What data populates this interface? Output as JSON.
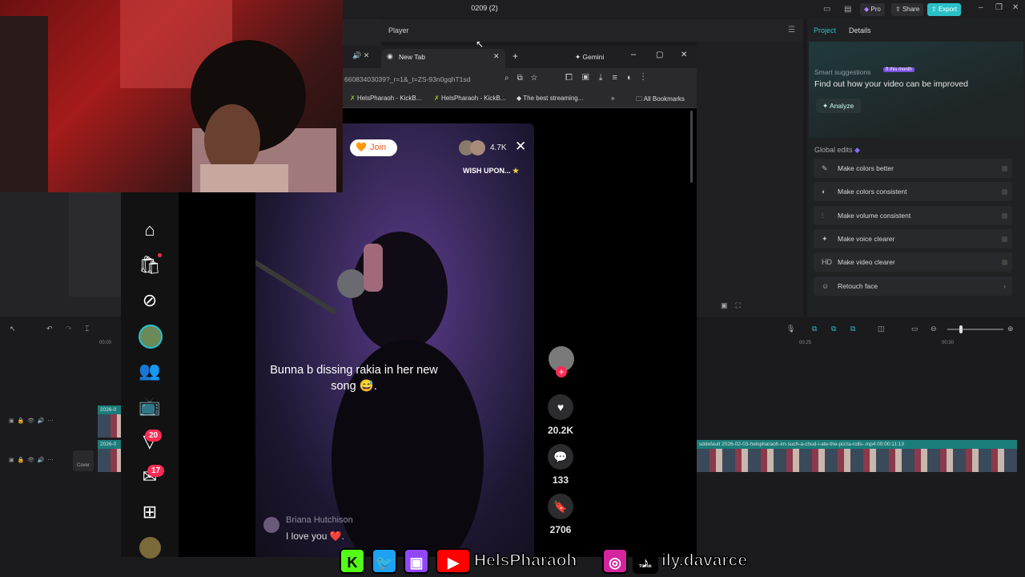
{
  "editor": {
    "project_title": "0209 (2)",
    "pro_label": "Pro",
    "share_label": "Share",
    "export_label": "Export",
    "player_label": "Player",
    "tabs": [
      "Project",
      "Details"
    ],
    "smart_suggestions_title": "Smart suggestions",
    "smart_badge": "ft this month",
    "smart_main": "Find out how your video can be improved",
    "analyze_label": "Analyze",
    "global_edits_title": "Global edits",
    "global_edits": [
      {
        "label": "Make colors better",
        "icon": "wand-icon",
        "glyph": "✎"
      },
      {
        "label": "Make colors consistent",
        "icon": "palette-icon",
        "glyph": "◐"
      },
      {
        "label": "Make volume consistent",
        "icon": "sliders-icon",
        "glyph": "⫶"
      },
      {
        "label": "Make voice clearer",
        "icon": "voice-icon",
        "glyph": "✦"
      },
      {
        "label": "Make video clearer",
        "icon": "hd-icon",
        "glyph": "HD"
      },
      {
        "label": "Retouch face",
        "icon": "face-icon",
        "glyph": "☺"
      }
    ],
    "timeline": {
      "ruler": [
        "00:00",
        "00:25",
        "00:30"
      ],
      "clip_label_left": "2026-0",
      "clip_label_right": "sddefault  2026-02-03-helspharaoh-im-such-a-chud-i-ate-the-pizza-rolls-.mp4  00:00:11:13",
      "cover_label": "Cover"
    }
  },
  "browser": {
    "tabs": [
      {
        "label": "New Tab"
      },
      {
        "label": "Gemini"
      }
    ],
    "address": "66083403039?_r=1&_t=ZS-93n0gqhT1sd",
    "bookmarks": [
      "HelsPharaoh - KickB...",
      "HelsPharaoh - KickB...",
      "The best streaming..."
    ],
    "all_bookmarks": "All Bookmarks"
  },
  "tiktok": {
    "join_label": "Join",
    "viewer_count": "4.7K",
    "wish_text": "WISH UPON...",
    "caption": "Bunna b dissing rakia in her new song 😅.",
    "likes": "20.2K",
    "comments": "133",
    "saves": "2706",
    "comment_name": "Briana Hutchison",
    "comment_text": "I love you ❤️.",
    "badges": {
      "friends": "20",
      "inbox": "17"
    }
  },
  "overlay": {
    "handle1": "HelsPharaoh",
    "handle2": "ily.davarce",
    "tiktok_label": "TikTok"
  }
}
